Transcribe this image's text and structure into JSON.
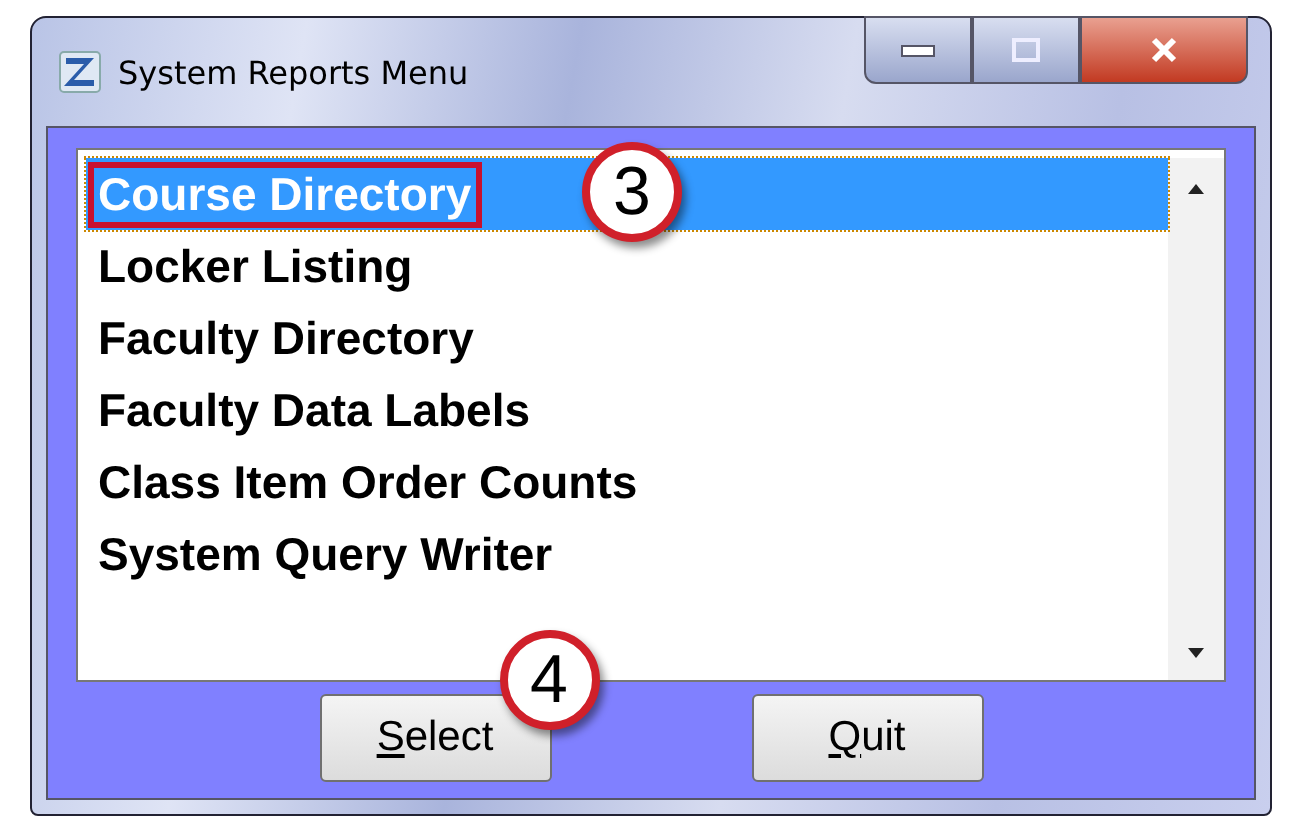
{
  "window": {
    "title": "System Reports Menu"
  },
  "list": {
    "items": [
      {
        "label": "Course Directory",
        "selected": true,
        "outlined": true
      },
      {
        "label": "Locker Listing",
        "selected": false,
        "outlined": false
      },
      {
        "label": "Faculty Directory",
        "selected": false,
        "outlined": false
      },
      {
        "label": "Faculty Data Labels",
        "selected": false,
        "outlined": false
      },
      {
        "label": "Class Item Order Counts",
        "selected": false,
        "outlined": false
      },
      {
        "label": "System Query Writer",
        "selected": false,
        "outlined": false
      }
    ]
  },
  "buttons": [
    {
      "mnemonic": "S",
      "rest": "elect",
      "callout": "4"
    },
    {
      "mnemonic": "Q",
      "rest": "uit"
    }
  ],
  "list_callout": "3"
}
